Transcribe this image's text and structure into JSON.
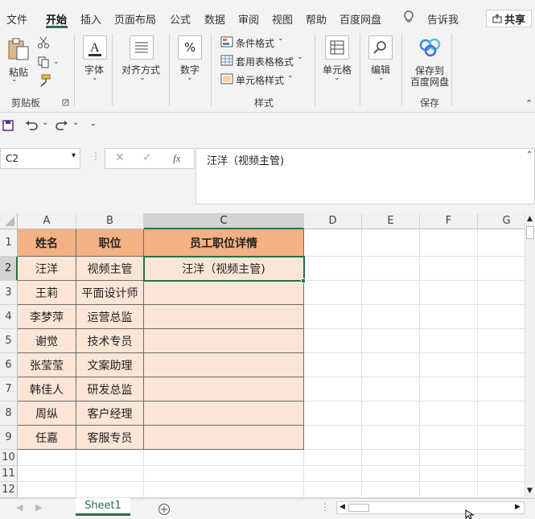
{
  "menu": {
    "items": [
      "文件",
      "开始",
      "插入",
      "页面布局",
      "公式",
      "数据",
      "审阅",
      "视图",
      "帮助",
      "百度网盘",
      "告诉我"
    ],
    "active": "开始",
    "share": "共享"
  },
  "ribbon": {
    "clipboard": {
      "paste": "粘贴",
      "group": "剪贴板"
    },
    "font": {
      "label": "字体"
    },
    "align": {
      "label": "对齐方式"
    },
    "number": {
      "label": "数字"
    },
    "styles": {
      "conditional": "条件格式",
      "table_format": "套用表格格式",
      "cell_styles": "单元格样式",
      "group": "样式"
    },
    "cells": {
      "label": "单元格"
    },
    "edit": {
      "label": "编辑"
    },
    "save": {
      "line1": "保存到",
      "line2": "百度网盘",
      "group": "保存"
    }
  },
  "formula_bar": {
    "name_box": "C2",
    "fx": "fx",
    "content": "汪洋（视频主管)"
  },
  "grid": {
    "columns": [
      "A",
      "B",
      "C",
      "D",
      "E",
      "F",
      "G"
    ],
    "rows": [
      "1",
      "2",
      "3",
      "4",
      "5",
      "6",
      "7",
      "8",
      "9",
      "10",
      "11",
      "12"
    ],
    "header": [
      "姓名",
      "职位",
      "员工职位详情"
    ],
    "data": [
      [
        "汪洋",
        "视频主管",
        "汪洋（视频主管)"
      ],
      [
        "王莉",
        "平面设计师",
        ""
      ],
      [
        "李梦萍",
        "运营总监",
        ""
      ],
      [
        "谢觉",
        "技术专员",
        ""
      ],
      [
        "张莹莹",
        "文案助理",
        ""
      ],
      [
        "韩佳人",
        "研发总监",
        ""
      ],
      [
        "周纵",
        "客户经理",
        ""
      ],
      [
        "任嘉",
        "客服专员",
        ""
      ]
    ],
    "colors": {
      "header_fill": "#f4b183",
      "data_fill": "#fbe5d6",
      "accent": "#217346"
    }
  },
  "sheets": {
    "active": "Sheet1"
  }
}
